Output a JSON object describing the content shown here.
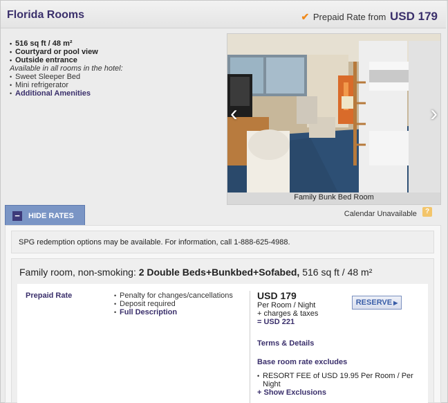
{
  "header": {
    "room_title": "Florida Rooms",
    "rate_prefix": "Prepaid Rate from",
    "rate_amount": "USD 179"
  },
  "features": {
    "size": "516 sq ft / 48 m²",
    "view": "Courtyard or pool view",
    "entrance": "Outside entrance",
    "available_note": "Available in all rooms in the hotel:",
    "bed": "Sweet Sleeper Bed",
    "fridge": "Mini refrigerator",
    "amenities_link": "Additional Amenities"
  },
  "photo": {
    "caption": "Family Bunk Bed Room"
  },
  "controls": {
    "hide_rates": "HIDE RATES",
    "calendar": "Calendar Unavailable",
    "help": "?"
  },
  "notice": "SPG redemption options may be available. For information, call 1-888-625-4988.",
  "room_type": {
    "prefix": "Family room, non-smoking: ",
    "beds": "2 Double Beds+Bunkbed+Sofabed,",
    "size": " 516 sq ft / 48 m²"
  },
  "rate": {
    "name": "Prepaid Rate",
    "terms": [
      "Penalty for changes/cancellations",
      "Deposit required"
    ],
    "full_description": "Full Description",
    "price": "USD 179",
    "per": "Per Room / Night",
    "charges": "+ charges & taxes",
    "total": "= USD 221",
    "reserve": "RESERVE",
    "terms_link": "Terms & Details",
    "excludes_title": "Base room rate excludes",
    "excludes_item": "RESORT FEE of USD 19.95 Per Room / Per Night",
    "show_exclusions": "+ Show Exclusions"
  },
  "colors": {
    "brand": "#3a2f6b",
    "accent": "#f08a1c",
    "hide_button": "#7a95c5"
  }
}
